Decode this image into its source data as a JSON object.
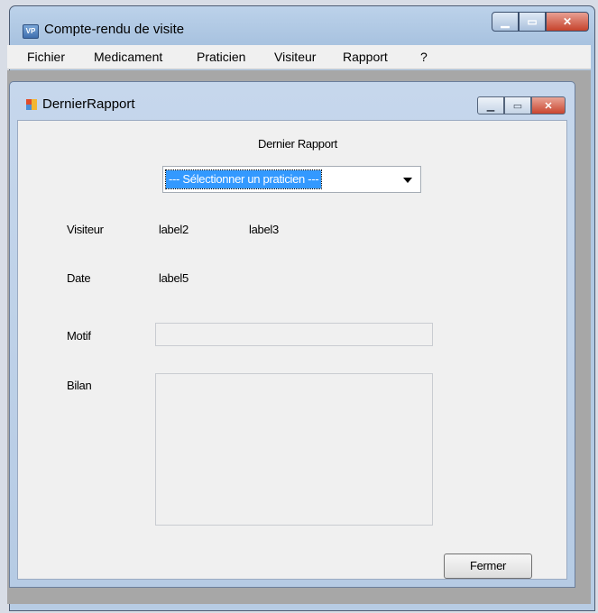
{
  "app": {
    "title": "Compte-rendu de visite",
    "icon_text": "VP"
  },
  "menu": {
    "items": [
      "Fichier",
      "Medicament",
      "Praticien",
      "Visiteur",
      "Rapport",
      "?"
    ]
  },
  "child_window": {
    "title": "DernierRapport"
  },
  "form": {
    "heading": "Dernier Rapport",
    "combo_selected": "--- Sélectionner un praticien ---",
    "visiteur_label": "Visiteur",
    "visiteur_value1": "label2",
    "visiteur_value2": "label3",
    "date_label": "Date",
    "date_value": "label5",
    "motif_label": "Motif",
    "motif_value": "",
    "bilan_label": "Bilan",
    "bilan_value": "",
    "close_button": "Fermer"
  },
  "colors": {
    "selection": "#3399ff",
    "close_button": "#c6432c"
  }
}
